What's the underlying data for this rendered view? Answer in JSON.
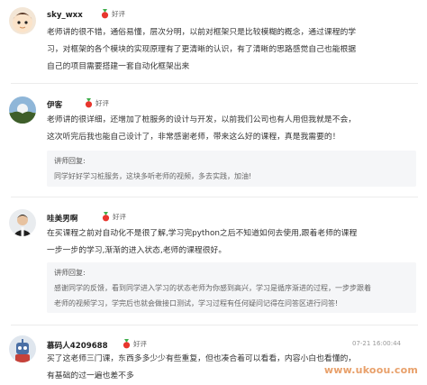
{
  "reviews": [
    {
      "username": "sky_wxx",
      "rating_label": "好评",
      "content_lines": [
        "老师讲的很不错，通俗易懂，层次分明，以前对框架只是比较模糊的概念，通过课程的学",
        "习，对框架的各个模块的实现原理有了更清晰的认识，有了清晰的思路感觉自己也能根据",
        "自己的项目需要搭建一套自动化框架出来"
      ]
    },
    {
      "username": "伊客",
      "rating_label": "好评",
      "content_lines": [
        "老师讲的很详细，还增加了桩服务的设计与开发，以前我们公司也有人用但我就是不会，",
        "这次听完后我也能自己设计了，非常感谢老师，带来这么好的课程，真是我需要的！"
      ],
      "reply_title": "讲师回复:",
      "reply_lines": [
        "同学好好学习桩服务，这块多听老师的视频，多去实践，加油!"
      ]
    },
    {
      "username": "哇美男啊",
      "rating_label": "好评",
      "content_lines": [
        "在买课程之前对自动化不是很了解,学习完python之后不知道如何去使用,跟着老师的课程",
        "一步一步的学习,渐渐的进入状态,老师的课程很好。"
      ],
      "reply_title": "讲师回复:",
      "reply_lines": [
        "感谢同学的反馈，看到同学进入学习的状态老师为你感到高兴，学习是循序渐进的过程，一步步跟着",
        "老师的视频学习，学完后也就会做接口测试，学习过程有任何疑问记得在问答区进行问答!"
      ]
    },
    {
      "username": "慕码人4209688",
      "rating_label": "好评",
      "time": "07-21 16:00:44",
      "content_lines": [
        "买了这老师三门课，东西多多少少有些重复，但也凑合着可以看看，内容小白也看懂的，",
        "有基础的过一遍也差不多"
      ]
    }
  ],
  "watermark": "www.ukoou.com",
  "colors": {
    "medal_red": "#e8362d",
    "medal_green": "#3fae4c",
    "reply_bg": "#f5f6f8"
  }
}
